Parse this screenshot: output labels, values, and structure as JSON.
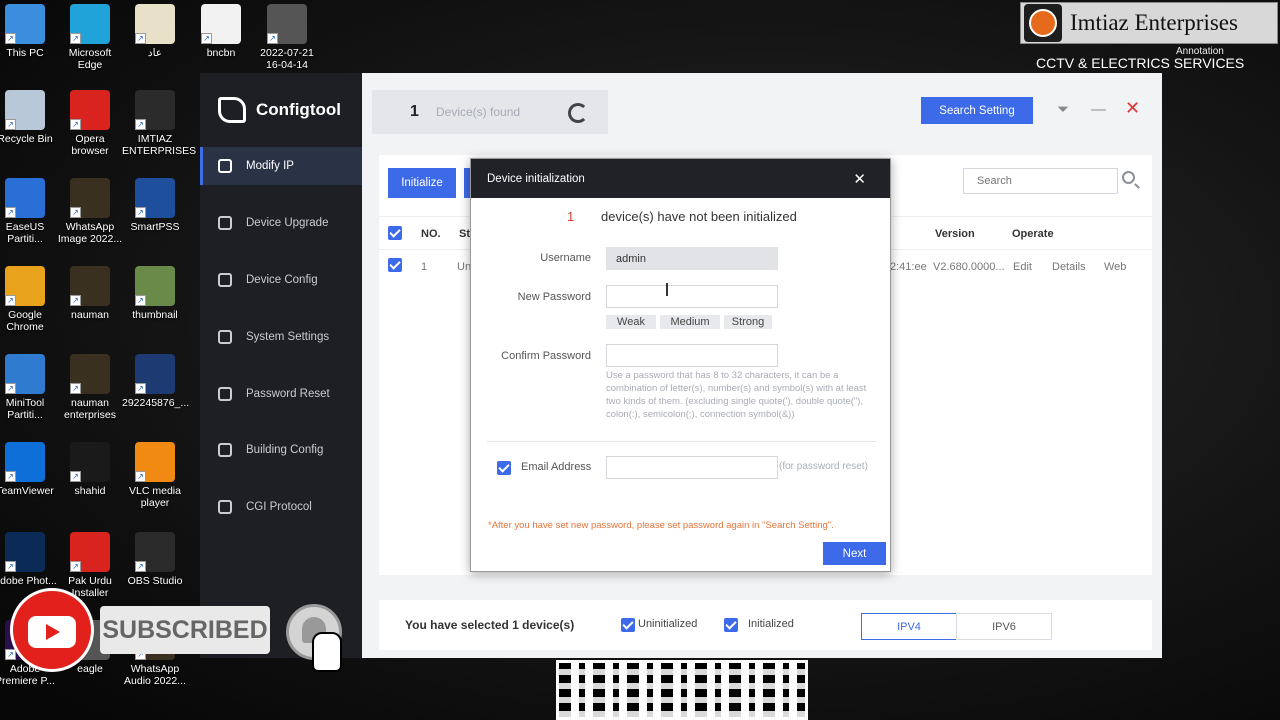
{
  "desktop_icons": [
    {
      "label": "This PC",
      "color": "#3b8ede"
    },
    {
      "label": "Microsoft Edge",
      "color": "#1fa3d8"
    },
    {
      "label": "عاد",
      "color": "#e8e0c8"
    },
    {
      "label": "bncbn",
      "color": "#f2f2f2"
    },
    {
      "label": "2022-07-21 16-04-14",
      "color": "#555555"
    },
    {
      "label": "Recycle Bin",
      "color": "#b9c8d8"
    },
    {
      "label": "Opera browser",
      "color": "#d9231f"
    },
    {
      "label": "IMTIAZ ENTERPRISES",
      "color": "#2b2b2b"
    },
    {
      "label": "EaseUS Partiti...",
      "color": "#2a6fd6"
    },
    {
      "label": "WhatsApp Image 2022...",
      "color": "#3a3020"
    },
    {
      "label": "SmartPSS",
      "color": "#1d4f9c"
    },
    {
      "label": "Google Chrome",
      "color": "#e9a21c"
    },
    {
      "label": "nauman",
      "color": "#3a3020"
    },
    {
      "label": "thumbnail",
      "color": "#6a8a4a"
    },
    {
      "label": "MiniTool Partiti...",
      "color": "#2f7bd0"
    },
    {
      "label": "nauman enterprises",
      "color": "#3a3020"
    },
    {
      "label": "292245876_...",
      "color": "#1d3b72"
    },
    {
      "label": "TeamViewer",
      "color": "#0e6fd8"
    },
    {
      "label": "shahid",
      "color": "#1a1a1a"
    },
    {
      "label": "VLC media player",
      "color": "#f08a12"
    },
    {
      "label": "Adobe Phot...",
      "color": "#0b2a55"
    },
    {
      "label": "Pak Urdu Installer",
      "color": "#d9231f"
    },
    {
      "label": "OBS Studio",
      "color": "#2a2a2a"
    },
    {
      "label": "Adobe Premiere P...",
      "color": "#2a0f4a"
    },
    {
      "label": "eagle",
      "color": "#555555"
    },
    {
      "label": "WhatsApp Audio 2022...",
      "color": "#3a3020"
    }
  ],
  "branding": {
    "name": "Imtiaz Enterprises",
    "subtitle": "CCTV & ELECTRICS SERVICES",
    "annotation": "Annotation"
  },
  "app": {
    "title": "Configtool",
    "sidebar": [
      {
        "label": "Modify IP",
        "icon": "modify-ip-icon",
        "active": true
      },
      {
        "label": "Device Upgrade",
        "icon": "upgrade-icon",
        "active": false
      },
      {
        "label": "Device Config",
        "icon": "device-config-icon",
        "active": false
      },
      {
        "label": "System Settings",
        "icon": "system-settings-icon",
        "active": false
      },
      {
        "label": "Password Reset",
        "icon": "password-reset-icon",
        "active": false
      },
      {
        "label": "Building Config",
        "icon": "building-config-icon",
        "active": false
      },
      {
        "label": "CGI Protocol",
        "icon": "cgi-protocol-icon",
        "active": false
      }
    ],
    "devices_found_count": "1",
    "devices_found_label": "Device(s) found",
    "search_setting_label": "Search Setting",
    "initialize_label": "Initialize",
    "search_placeholder": "Search",
    "table": {
      "headers": {
        "no": "NO.",
        "status": "St",
        "version": "Version",
        "operate": "Operate"
      },
      "rows": [
        {
          "no": "1",
          "status": "Un",
          "time": "2:41:ee",
          "version": "V2.680.0000...",
          "edit": "Edit",
          "details": "Details",
          "web": "Web"
        }
      ]
    },
    "footer": {
      "selected_text": "You have selected 1  device(s)",
      "uninitialized": "Uninitialized",
      "initialized": "Initialized",
      "ipv4": "IPV4",
      "ipv6": "IPV6"
    }
  },
  "dialog": {
    "title": "Device initialization",
    "count": "1",
    "message": "device(s) have not been initialized",
    "username_label": "Username",
    "username_value": "admin",
    "new_password_label": "New Password",
    "strength": [
      "Weak",
      "Medium",
      "Strong"
    ],
    "confirm_password_label": "Confirm Password",
    "hint": "Use a password that has 8 to 32 characters, it can be a combination of letter(s), number(s) and symbol(s) with at least two kinds of them. (excluding single quote('), double quote(\"), colon(:), semicolon(;), connection symbol(&))",
    "email_label": "Email Address",
    "email_note": "(for password reset)",
    "warning": "*After you have set new password, please set password again in \"Search Setting\".",
    "next_label": "Next"
  },
  "overlay": {
    "subscribed_label": "SUBSCRIBED"
  },
  "colors": {
    "accent": "#3d6ae8",
    "alert_red": "#d9402b",
    "warning_orange": "#e5743a",
    "sidebar_bg": "#1d1f25"
  }
}
